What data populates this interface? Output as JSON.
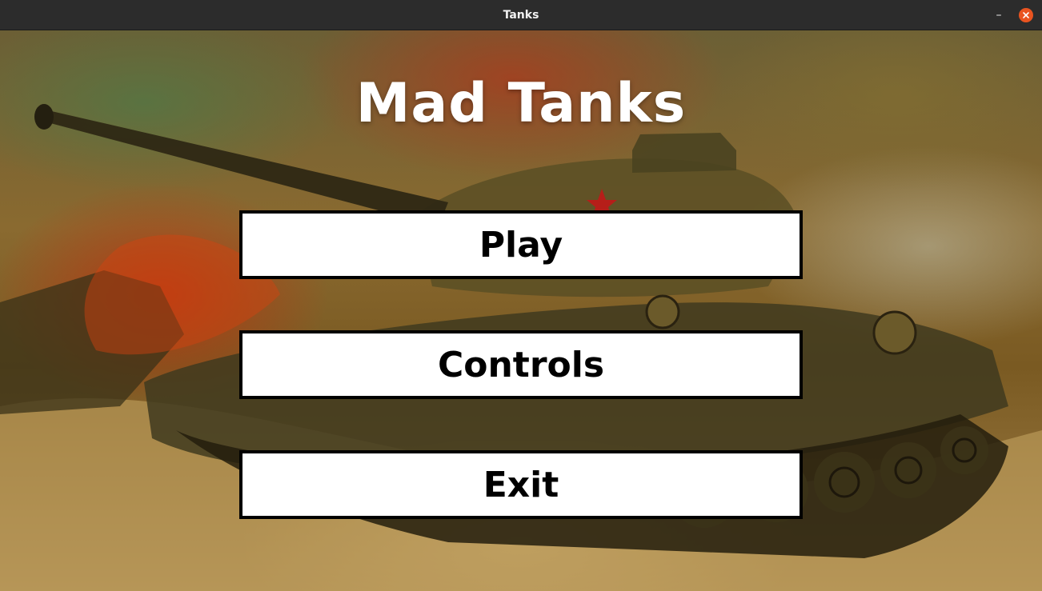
{
  "window": {
    "title": "Tanks",
    "minimize_label": "–",
    "accent": "#e95420"
  },
  "menu": {
    "title": "Mad Tanks",
    "buttons": {
      "play": "Play",
      "controls": "Controls",
      "exit": "Exit"
    }
  },
  "icons": {
    "close": "close-x-icon",
    "minimize": "minimize-icon"
  }
}
